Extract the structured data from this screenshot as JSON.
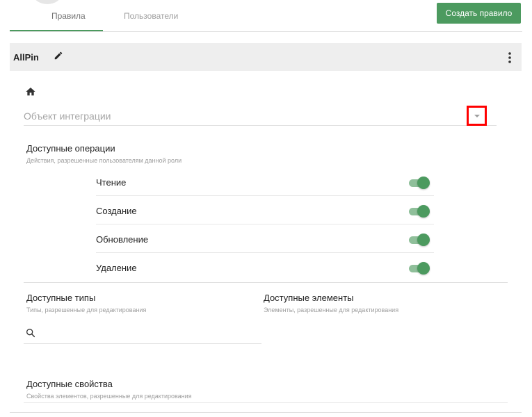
{
  "tabs": [
    {
      "label": "Правила",
      "active": true
    },
    {
      "label": "Пользователи",
      "active": false
    }
  ],
  "create_button_label": "Создать правило",
  "colors": {
    "accent": "#4c9a5f",
    "highlight_box": "#ff0000"
  },
  "card": {
    "title": "AllPin",
    "integration_placeholder": "Объект интеграции",
    "operations": {
      "title": "Доступные операции",
      "subtitle": "Действия, разрешенные пользователям данной роли",
      "items": [
        {
          "label": "Чтение",
          "enabled": true
        },
        {
          "label": "Создание",
          "enabled": true
        },
        {
          "label": "Обновление",
          "enabled": true
        },
        {
          "label": "Удаление",
          "enabled": true
        }
      ]
    },
    "types": {
      "title": "Доступные типы",
      "subtitle": "Типы, разрешенные для редактирования"
    },
    "elements": {
      "title": "Доступные элементы",
      "subtitle": "Элементы, разрешенные для редактирования"
    },
    "properties": {
      "title": "Доступные свойства",
      "subtitle": "Свойства элементов, разрешенные для редактирования"
    }
  },
  "icons": [
    "edit-icon",
    "more-vert-icon",
    "home-icon",
    "dropdown-arrow-icon",
    "search-icon"
  ]
}
